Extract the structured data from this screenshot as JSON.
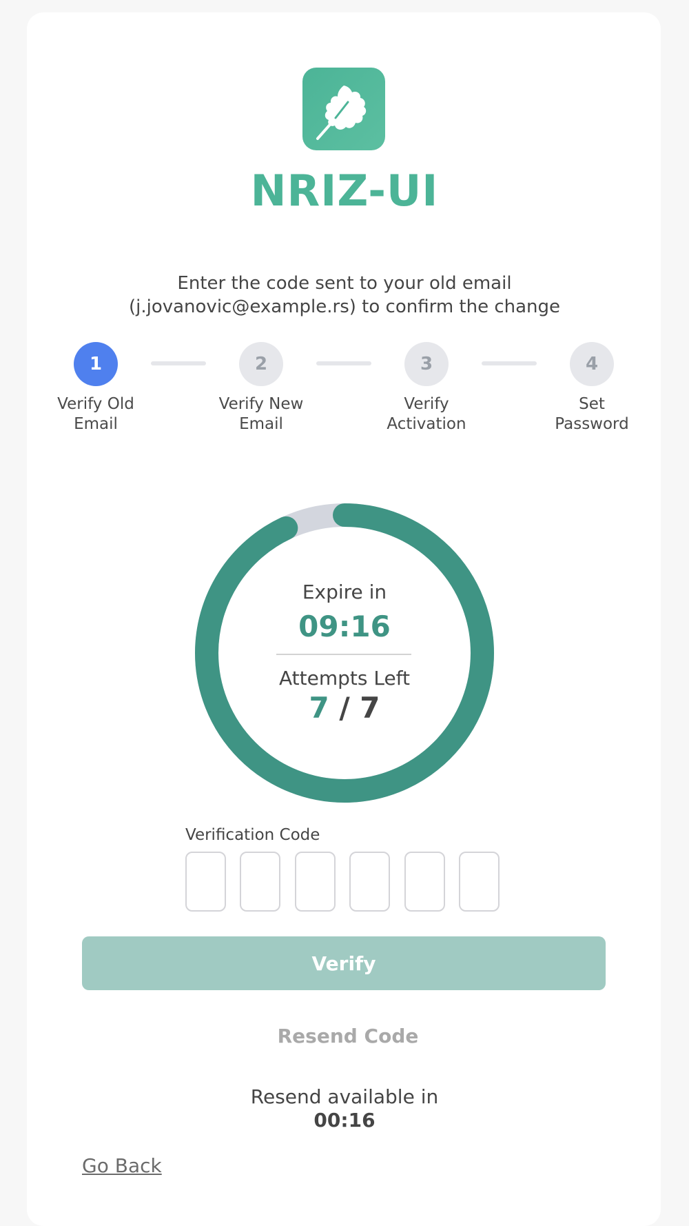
{
  "brand": {
    "name": "NRIZ-UI",
    "logo_icon": "oak-leaf-icon",
    "color": "#4cb497"
  },
  "instruction": {
    "line1": "Enter the code sent to your old email",
    "line2": "(j.jovanovic@example.rs) to confirm the change"
  },
  "steps": [
    {
      "number": "1",
      "label_line1": "Verify Old",
      "label_line2": "Email",
      "active": true
    },
    {
      "number": "2",
      "label_line1": "Verify New",
      "label_line2": "Email",
      "active": false
    },
    {
      "number": "3",
      "label_line1": "Verify",
      "label_line2": "Activation",
      "active": false
    },
    {
      "number": "4",
      "label_line1": "Set",
      "label_line2": "Password",
      "active": false
    }
  ],
  "timer": {
    "expire_label": "Expire in",
    "expire_value": "09:16",
    "remaining_fraction": 0.93,
    "ring_color": "#3f9484",
    "track_color": "#d3d6de"
  },
  "attempts": {
    "label": "Attempts Left",
    "left": "7",
    "separator": " / ",
    "total": "7"
  },
  "code": {
    "label": "Verification Code",
    "digits": [
      "",
      "",
      "",
      "",
      "",
      ""
    ]
  },
  "actions": {
    "verify_label": "Verify",
    "resend_label": "Resend Code",
    "resend_info_label": "Resend available in",
    "resend_timer": "00:16",
    "go_back_label": "Go Back"
  },
  "colors": {
    "primary": "#4cb497",
    "step_active": "#4f80ee",
    "verify_disabled": "#a0cac2"
  }
}
